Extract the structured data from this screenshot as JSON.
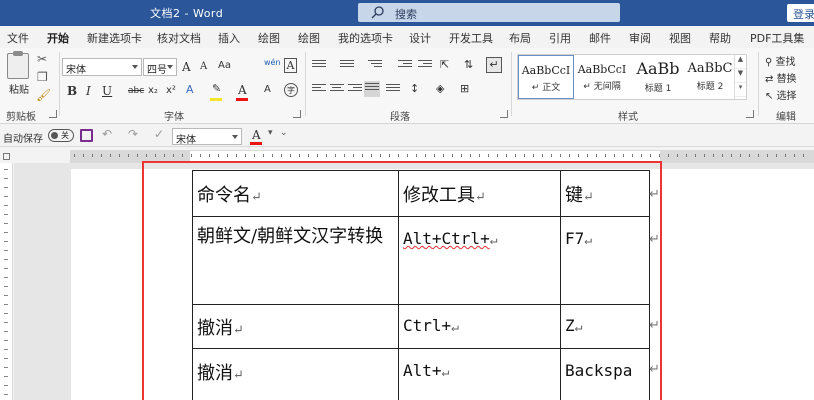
{
  "titlebar": {
    "title": "文档2 - Word",
    "search_placeholder": "搜索",
    "login": "登录"
  },
  "tabs": [
    "文件",
    "开始",
    "新建选项卡",
    "核对文档",
    "插入",
    "绘图",
    "绘图",
    "我的选项卡",
    "设计",
    "开发工具",
    "布局",
    "引用",
    "邮件",
    "审阅",
    "视图",
    "帮助",
    "PDF工具集"
  ],
  "ribbon": {
    "clipboard": {
      "paste": "粘贴",
      "label": "剪贴板"
    },
    "font": {
      "name": "宋体",
      "size": "四号",
      "label": "字体",
      "clear_fmt": "A",
      "bold": "B",
      "italic": "I",
      "underline": "U",
      "strike": "abc",
      "sub": "x₂",
      "sup": "x²",
      "grow": "A",
      "shrink": "A",
      "case": "Aa",
      "phonetic": "wén",
      "border_char": "A",
      "font_color": "A",
      "circle": "字"
    },
    "paragraph": {
      "label": "段落"
    },
    "styles": {
      "label": "样式",
      "items": [
        {
          "sample": "AaBbCcI",
          "name": "↵ 正文"
        },
        {
          "sample": "AaBbCcI",
          "name": "↵ 无间隔"
        },
        {
          "sample": "AaBb",
          "name": "标题 1"
        },
        {
          "sample": "AaBbC",
          "name": "标题 2"
        }
      ]
    },
    "editing": {
      "label": "编辑",
      "find": "查找",
      "replace": "替换",
      "select": "选择"
    }
  },
  "qat": {
    "autosave": "自动保存",
    "toggle": "关",
    "font": "宋体",
    "font_color": "A"
  },
  "table": {
    "rows": [
      [
        "命令名",
        "修改工具",
        "键"
      ],
      [
        "朝鲜文/朝鲜文汉字转换",
        "Alt+Ctrl+",
        "F7"
      ],
      [
        "撤消",
        "Ctrl+",
        "Z"
      ],
      [
        "撤消",
        "Alt+",
        "Backspa"
      ]
    ],
    "para_mark": "↵",
    "row_mark": "↵"
  }
}
